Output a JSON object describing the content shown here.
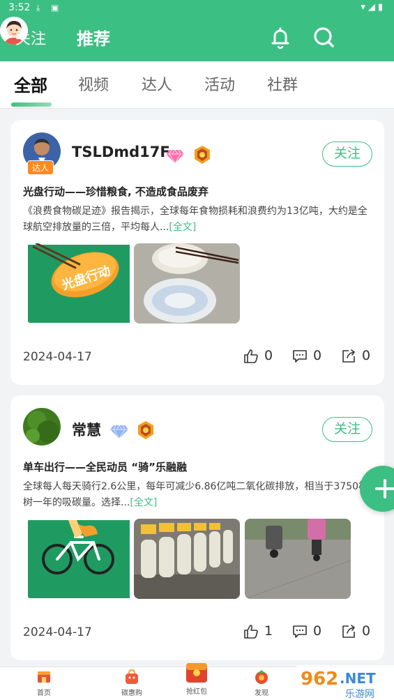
{
  "status": {
    "time": "3:52"
  },
  "topbar": {
    "follow_tab": "关注",
    "recommend_tab": "推荐"
  },
  "categories": [
    "全部",
    "视频",
    "达人",
    "活动",
    "社群"
  ],
  "posts": [
    {
      "username": "TSLDmd17F",
      "badge": "达人",
      "follow_label": "关注",
      "title": "光盘行动——珍惜粮食, 不造成食品废弃",
      "body": "《浪费食物碳足迹》报告揭示，全球每年食物损耗和浪费约为13亿吨，大约是全球航空排放量的三倍，平均每人...",
      "more": "[全文]",
      "image_text": "光盘行动",
      "date": "2024-04-17",
      "likes": "0",
      "comments": "0",
      "shares": "0"
    },
    {
      "username": "常慧",
      "follow_label": "关注",
      "title": "单车出行——全民动员 “骑”乐融融",
      "body": "全球每人每天骑行2.6公里，每年可减少6.86亿吨二氧化碳排放，相当于3750棵树一年的吸碳量。选择...",
      "more": "[全文]",
      "date": "2024-04-17",
      "likes": "1",
      "comments": "0",
      "shares": "0"
    }
  ],
  "bottom_nav": [
    "首页",
    "碳惠购",
    "抢红包",
    "发现"
  ],
  "watermark": "962.NET 乐游网",
  "colors": {
    "brand": "#3cbf83",
    "badge": "#ff8a1e"
  }
}
